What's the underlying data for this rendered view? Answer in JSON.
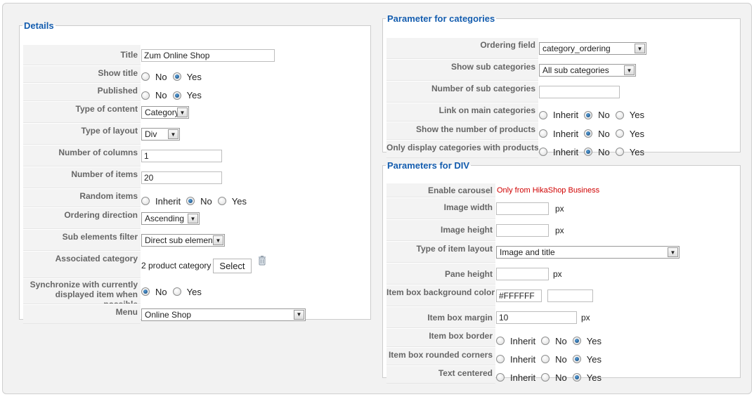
{
  "details": {
    "legend": "Details",
    "title": {
      "label": "Title",
      "value": "Zum Online Shop"
    },
    "show_title": {
      "label": "Show title",
      "options": [
        "No",
        "Yes"
      ],
      "selected": "Yes"
    },
    "published": {
      "label": "Published",
      "options": [
        "No",
        "Yes"
      ],
      "selected": "Yes"
    },
    "type_of_content": {
      "label": "Type of content",
      "value": "Category"
    },
    "type_of_layout": {
      "label": "Type of layout",
      "value": "Div"
    },
    "number_of_columns": {
      "label": "Number of columns",
      "value": "1"
    },
    "number_of_items": {
      "label": "Number of items",
      "value": "20"
    },
    "random_items": {
      "label": "Random items",
      "options": [
        "Inherit",
        "No",
        "Yes"
      ],
      "selected": "No"
    },
    "ordering_direction": {
      "label": "Ordering direction",
      "value": "Ascending"
    },
    "sub_elements_filter": {
      "label": "Sub elements filter",
      "value": "Direct sub elements"
    },
    "associated_category": {
      "label": "Associated category",
      "value": "2 product category",
      "button": "Select"
    },
    "synchronize": {
      "label": "Synchronize with currently displayed item when possible",
      "options": [
        "No",
        "Yes"
      ],
      "selected": "No"
    },
    "menu": {
      "label": "Menu",
      "value": "Online Shop"
    }
  },
  "categories": {
    "legend": "Parameter for categories",
    "ordering_field": {
      "label": "Ordering field",
      "value": "category_ordering"
    },
    "show_sub_categories": {
      "label": "Show sub categories",
      "value": "All sub categories"
    },
    "number_of_sub_categories": {
      "label": "Number of sub categories",
      "value": ""
    },
    "link_on_main_categories": {
      "label": "Link on main categories",
      "options": [
        "Inherit",
        "No",
        "Yes"
      ],
      "selected": "No"
    },
    "show_number_of_products": {
      "label": "Show the number of products",
      "options": [
        "Inherit",
        "No",
        "Yes"
      ],
      "selected": "No"
    },
    "only_display_with_products": {
      "label": "Only display categories with products",
      "options": [
        "Inherit",
        "No",
        "Yes"
      ],
      "selected": "No"
    }
  },
  "div": {
    "legend": "Parameters for DIV",
    "enable_carousel": {
      "label": "Enable carousel",
      "value": "Only from HikaShop Business"
    },
    "image_width": {
      "label": "Image width",
      "value": "",
      "unit": "px"
    },
    "image_height": {
      "label": "Image height",
      "value": "",
      "unit": "px"
    },
    "type_of_item_layout": {
      "label": "Type of item layout",
      "value": "Image and title"
    },
    "pane_height": {
      "label": "Pane height",
      "value": "",
      "unit": "px"
    },
    "item_box_background_color": {
      "label": "Item box background color",
      "value": "#FFFFFF",
      "swatch": "#FFFFFF"
    },
    "item_box_margin": {
      "label": "Item box margin",
      "value": "10",
      "unit": "px"
    },
    "item_box_border": {
      "label": "Item box border",
      "options": [
        "Inherit",
        "No",
        "Yes"
      ],
      "selected": "Yes"
    },
    "item_box_rounded_corners": {
      "label": "Item box rounded corners",
      "options": [
        "Inherit",
        "No",
        "Yes"
      ],
      "selected": "Yes"
    },
    "text_centered": {
      "label": "Text centered",
      "options": [
        "Inherit",
        "No",
        "Yes"
      ],
      "selected": "Yes"
    }
  },
  "colors": {
    "legend": "#135cae",
    "notice": "#d00000",
    "radio_selected": "#0a3f74",
    "label_bg": "#f3f3f3"
  },
  "icons": {
    "select_arrow": "chevron-down-icon",
    "delete": "trash-icon"
  }
}
